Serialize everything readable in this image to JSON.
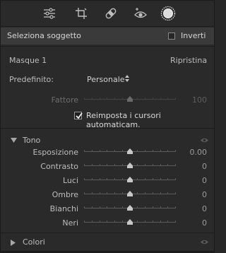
{
  "toolbar": {
    "tools": [
      {
        "icon": "sliders-icon",
        "active": false
      },
      {
        "icon": "crop-icon",
        "active": false
      },
      {
        "icon": "healing-icon",
        "active": false
      },
      {
        "icon": "red-eye-icon",
        "active": false
      },
      {
        "icon": "masking-icon",
        "active": true
      }
    ]
  },
  "subject": {
    "label": "Seleziona soggetto",
    "invert_label": "Inverti",
    "invert_checked": false
  },
  "mask": {
    "name": "Masque 1",
    "reset_label": "Ripristina",
    "preset_label": "Predefinito:",
    "preset_value": "Personale",
    "amount": {
      "label": "Fattore",
      "value": "100",
      "position": 0.5
    },
    "auto_reset": {
      "label": "Reimposta i cursori automaticam.",
      "checked": true
    }
  },
  "tone": {
    "title": "Tono",
    "rows": [
      {
        "label": "Esposizione",
        "value": "0.00",
        "position": 0.5
      },
      {
        "label": "Contrasto",
        "value": "0",
        "position": 0.5
      },
      {
        "label": "Luci",
        "value": "0",
        "position": 0.5
      },
      {
        "label": "Ombre",
        "value": "0",
        "position": 0.5
      },
      {
        "label": "Bianchi",
        "value": "0",
        "position": 0.5
      },
      {
        "label": "Neri",
        "value": "0",
        "position": 0.5
      }
    ]
  },
  "color": {
    "title": "Colori"
  },
  "colors": {
    "panel_bg": "#2a2a2a",
    "header_bg": "#3a3a3a",
    "text": "#bdbdbd",
    "thumb": "#c8c8c8"
  }
}
